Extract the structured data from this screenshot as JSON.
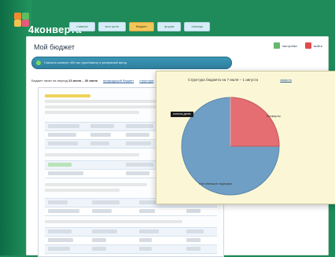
{
  "logo": {
    "text": "конверта",
    "prefix": "4"
  },
  "nav": {
    "tabs": [
      {
        "label": "главная"
      },
      {
        "label": "мои цели"
      },
      {
        "label": "бюджет",
        "active": true
      },
      {
        "label": "форум"
      },
      {
        "label": "помощь"
      }
    ]
  },
  "page": {
    "title": "Мой бюджет",
    "links": [
      {
        "label": "настройки",
        "icon": "settings-icon"
      },
      {
        "label": "выйти",
        "icon": "logout-icon"
      }
    ]
  },
  "notice": {
    "text": "Списано конверт 400 грн (пробовать) в резервный фонд"
  },
  "period": {
    "prefix": "Бюджет начат на период",
    "range": "23 июля – 30 июля",
    "link1": "предыдущий бюджет",
    "link2": "структура"
  },
  "popup": {
    "title": "Структура бюджета на 7 июля – 1 августа",
    "close": "закрыть",
    "callout": "остаток денег",
    "pie_labels": [
      "Конверты",
      "Нагоняющие издержки"
    ]
  },
  "colors": {
    "brand": "#1f8a5a",
    "notice": "#2f7e9d",
    "active_tab": "#f3c65a",
    "pie_red": "#e46e72",
    "pie_blue": "#6f9fc5"
  }
}
